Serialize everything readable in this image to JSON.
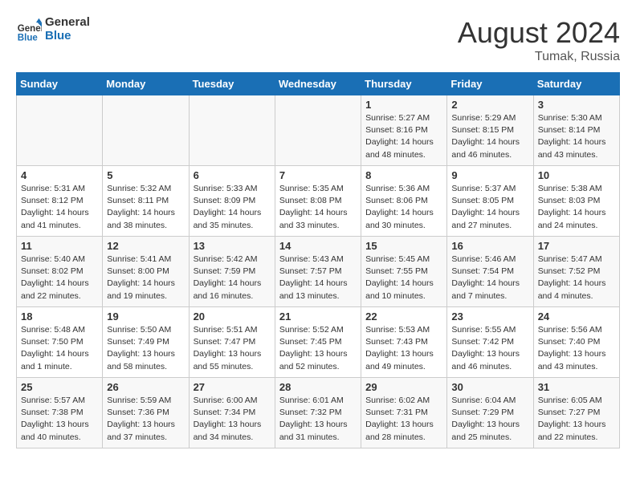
{
  "header": {
    "logo_line1": "General",
    "logo_line2": "Blue",
    "month_year": "August 2024",
    "location": "Tumak, Russia"
  },
  "days_of_week": [
    "Sunday",
    "Monday",
    "Tuesday",
    "Wednesday",
    "Thursday",
    "Friday",
    "Saturday"
  ],
  "weeks": [
    [
      {
        "day": "",
        "info": ""
      },
      {
        "day": "",
        "info": ""
      },
      {
        "day": "",
        "info": ""
      },
      {
        "day": "",
        "info": ""
      },
      {
        "day": "1",
        "info": "Sunrise: 5:27 AM\nSunset: 8:16 PM\nDaylight: 14 hours\nand 48 minutes."
      },
      {
        "day": "2",
        "info": "Sunrise: 5:29 AM\nSunset: 8:15 PM\nDaylight: 14 hours\nand 46 minutes."
      },
      {
        "day": "3",
        "info": "Sunrise: 5:30 AM\nSunset: 8:14 PM\nDaylight: 14 hours\nand 43 minutes."
      }
    ],
    [
      {
        "day": "4",
        "info": "Sunrise: 5:31 AM\nSunset: 8:12 PM\nDaylight: 14 hours\nand 41 minutes."
      },
      {
        "day": "5",
        "info": "Sunrise: 5:32 AM\nSunset: 8:11 PM\nDaylight: 14 hours\nand 38 minutes."
      },
      {
        "day": "6",
        "info": "Sunrise: 5:33 AM\nSunset: 8:09 PM\nDaylight: 14 hours\nand 35 minutes."
      },
      {
        "day": "7",
        "info": "Sunrise: 5:35 AM\nSunset: 8:08 PM\nDaylight: 14 hours\nand 33 minutes."
      },
      {
        "day": "8",
        "info": "Sunrise: 5:36 AM\nSunset: 8:06 PM\nDaylight: 14 hours\nand 30 minutes."
      },
      {
        "day": "9",
        "info": "Sunrise: 5:37 AM\nSunset: 8:05 PM\nDaylight: 14 hours\nand 27 minutes."
      },
      {
        "day": "10",
        "info": "Sunrise: 5:38 AM\nSunset: 8:03 PM\nDaylight: 14 hours\nand 24 minutes."
      }
    ],
    [
      {
        "day": "11",
        "info": "Sunrise: 5:40 AM\nSunset: 8:02 PM\nDaylight: 14 hours\nand 22 minutes."
      },
      {
        "day": "12",
        "info": "Sunrise: 5:41 AM\nSunset: 8:00 PM\nDaylight: 14 hours\nand 19 minutes."
      },
      {
        "day": "13",
        "info": "Sunrise: 5:42 AM\nSunset: 7:59 PM\nDaylight: 14 hours\nand 16 minutes."
      },
      {
        "day": "14",
        "info": "Sunrise: 5:43 AM\nSunset: 7:57 PM\nDaylight: 14 hours\nand 13 minutes."
      },
      {
        "day": "15",
        "info": "Sunrise: 5:45 AM\nSunset: 7:55 PM\nDaylight: 14 hours\nand 10 minutes."
      },
      {
        "day": "16",
        "info": "Sunrise: 5:46 AM\nSunset: 7:54 PM\nDaylight: 14 hours\nand 7 minutes."
      },
      {
        "day": "17",
        "info": "Sunrise: 5:47 AM\nSunset: 7:52 PM\nDaylight: 14 hours\nand 4 minutes."
      }
    ],
    [
      {
        "day": "18",
        "info": "Sunrise: 5:48 AM\nSunset: 7:50 PM\nDaylight: 14 hours\nand 1 minute."
      },
      {
        "day": "19",
        "info": "Sunrise: 5:50 AM\nSunset: 7:49 PM\nDaylight: 13 hours\nand 58 minutes."
      },
      {
        "day": "20",
        "info": "Sunrise: 5:51 AM\nSunset: 7:47 PM\nDaylight: 13 hours\nand 55 minutes."
      },
      {
        "day": "21",
        "info": "Sunrise: 5:52 AM\nSunset: 7:45 PM\nDaylight: 13 hours\nand 52 minutes."
      },
      {
        "day": "22",
        "info": "Sunrise: 5:53 AM\nSunset: 7:43 PM\nDaylight: 13 hours\nand 49 minutes."
      },
      {
        "day": "23",
        "info": "Sunrise: 5:55 AM\nSunset: 7:42 PM\nDaylight: 13 hours\nand 46 minutes."
      },
      {
        "day": "24",
        "info": "Sunrise: 5:56 AM\nSunset: 7:40 PM\nDaylight: 13 hours\nand 43 minutes."
      }
    ],
    [
      {
        "day": "25",
        "info": "Sunrise: 5:57 AM\nSunset: 7:38 PM\nDaylight: 13 hours\nand 40 minutes."
      },
      {
        "day": "26",
        "info": "Sunrise: 5:59 AM\nSunset: 7:36 PM\nDaylight: 13 hours\nand 37 minutes."
      },
      {
        "day": "27",
        "info": "Sunrise: 6:00 AM\nSunset: 7:34 PM\nDaylight: 13 hours\nand 34 minutes."
      },
      {
        "day": "28",
        "info": "Sunrise: 6:01 AM\nSunset: 7:32 PM\nDaylight: 13 hours\nand 31 minutes."
      },
      {
        "day": "29",
        "info": "Sunrise: 6:02 AM\nSunset: 7:31 PM\nDaylight: 13 hours\nand 28 minutes."
      },
      {
        "day": "30",
        "info": "Sunrise: 6:04 AM\nSunset: 7:29 PM\nDaylight: 13 hours\nand 25 minutes."
      },
      {
        "day": "31",
        "info": "Sunrise: 6:05 AM\nSunset: 7:27 PM\nDaylight: 13 hours\nand 22 minutes."
      }
    ]
  ]
}
